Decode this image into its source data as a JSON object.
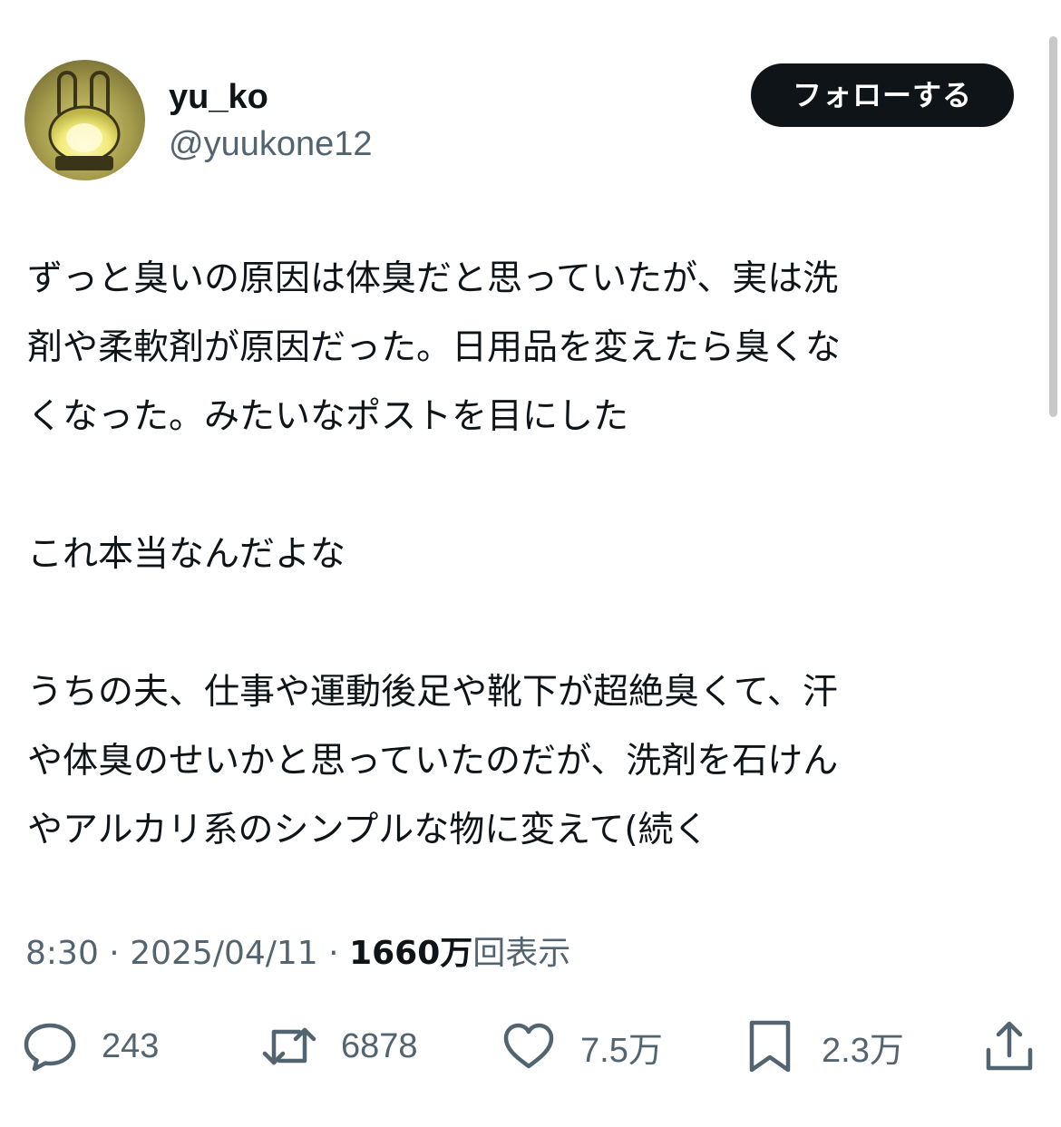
{
  "user": {
    "display_name": "yu_ko",
    "handle": "@yuukone12"
  },
  "follow_button": {
    "label": "フォローする"
  },
  "tweet": {
    "lines": [
      "ずっと臭いの原因は体臭だと思っていたが、実は洗",
      "剤や柔軟剤が原因だった。日用品を変えたら臭くな",
      "くなった。みたいなポストを目にした",
      "",
      "これ本当なんだよな",
      "",
      "うちの夫、仕事や運動後足や靴下が超絶臭くて、汗",
      "や体臭のせいかと思っていたのだが、洗剤を石けん",
      "やアルカリ系のシンプルな物に変えて(続く"
    ]
  },
  "meta": {
    "time": "8:30",
    "separator": "·",
    "date": "2025/04/11",
    "views_count": "1660万",
    "views_label": "回表示"
  },
  "actions": {
    "reply_count": "243",
    "repost_count": "6878",
    "like_count": "7.5万",
    "bookmark_count": "2.3万"
  },
  "icons": {
    "reply": "reply-icon",
    "repost": "repost-icon",
    "like": "heart-icon",
    "bookmark": "bookmark-icon",
    "share": "share-icon"
  },
  "colors": {
    "text": "#0f1419",
    "secondary": "#536471",
    "button_bg": "#0f1419",
    "button_text": "#ffffff"
  }
}
